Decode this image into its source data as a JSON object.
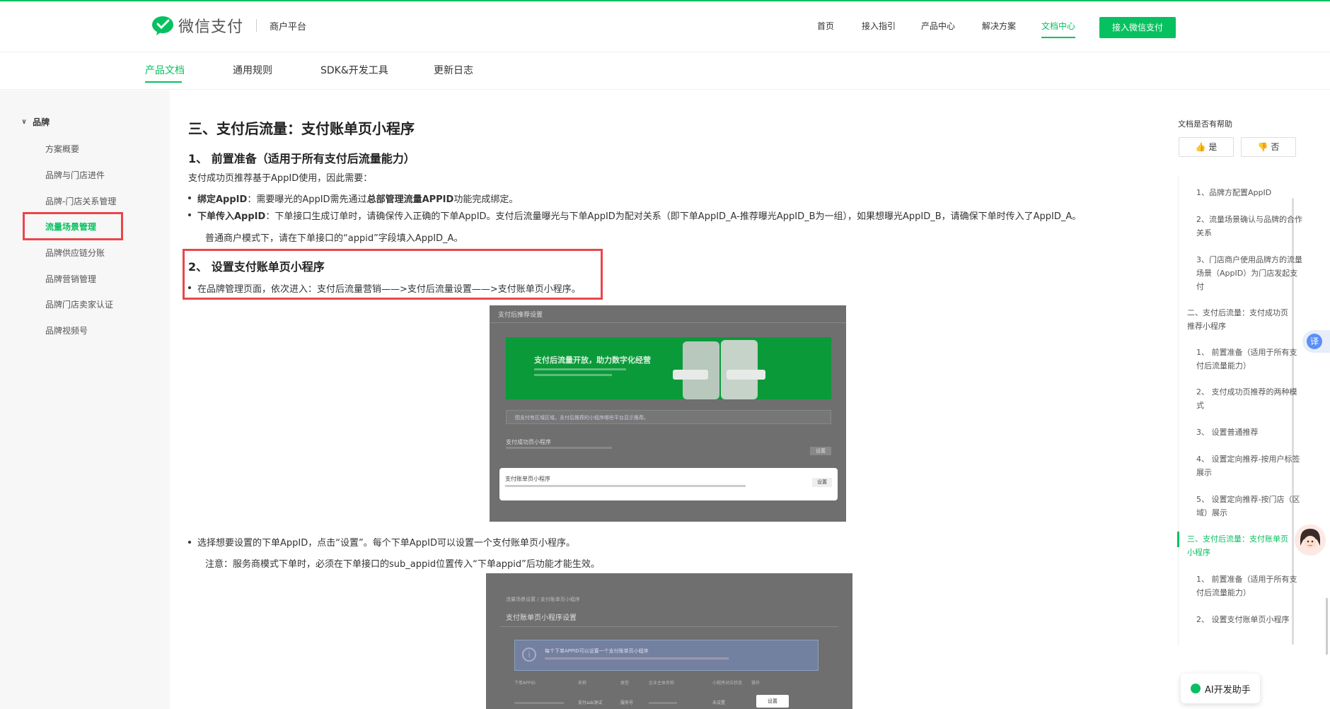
{
  "header": {
    "brand": "微信支付",
    "subbrand": "商户平台",
    "nav": [
      "首页",
      "接入指引",
      "产品中心",
      "解决方案",
      "文档中心"
    ],
    "active_nav": "文档中心",
    "cta": "接入微信支付"
  },
  "subnav": {
    "tabs": [
      "产品文档",
      "通用规则",
      "SDK&开发工具",
      "更新日志"
    ],
    "active": "产品文档"
  },
  "sidebar": {
    "group": "品牌",
    "items": [
      "方案概要",
      "品牌与门店进件",
      "品牌-门店关系管理",
      "流量场景管理",
      "品牌供应链分账",
      "品牌营销管理",
      "品牌门店卖家认证",
      "品牌视频号"
    ],
    "active": "流量场景管理"
  },
  "article": {
    "h1": "三、支付后流量：支付账单页小程序",
    "s1_title": "1、 前置准备（适用于所有支付后流量能力）",
    "s1_intro": "支付成功页推荐基于AppID使用，因此需要：",
    "b1_label": "绑定AppID",
    "b1_pre": "：需要曝光的AppID需先通过",
    "b1_bold": "总部管理流量APPID",
    "b1_post": "功能完成绑定。",
    "b2_label": "下单传入AppID",
    "b2_text": "：下单接口生成订单时，请确保传入正确的下单AppID。支付后流量曝光与下单AppID为配对关系（即下单AppID_A-推荐曝光AppID_B为一组），如果想曝光AppID_B，请确保下单时传入了AppID_A。",
    "b2_note": "普通商户模式下，请在下单接口的“appid”字段填入AppID_A。",
    "s2_title": "2、 设置支付账单页小程序",
    "s2_bullet": "在品牌管理页面，依次进入：支付后流量营销——>支付后流量设置——>支付账单页小程序。",
    "shot1": {
      "title": "支付后推荐设置",
      "banner": "支付后流量开放，助力数字化经营",
      "notice": "图支付有区域区域，支付后推荐的小程序哪些平台显示推荐。",
      "row1_title": "支付成功页小程序",
      "row1_button": "设置",
      "row2_title": "支付账单页小程序",
      "row2_button": "设置"
    },
    "s3_bullet": "选择想要设置的下单AppID，点击“设置”。每个下单AppID可以设置一个支付账单页小程序。",
    "s3_note": "注意：服务商模式下单时，必须在下单接口的sub_appid位置传入“下单appid”后功能才能生效。",
    "shot2": {
      "crumb": "流量场景设置 / 支付账单页小程序",
      "title": "支付账单页小程序设置",
      "info": "每个下单APPID可以设置一个支付账单页小程序",
      "headers": [
        "下单APPID",
        "名称",
        "类型",
        "企业主体名称",
        "小程序对应状态",
        "操作"
      ],
      "row": [
        "",
        "支付ask测试",
        "服务号",
        "",
        "未设置",
        "设置"
      ]
    }
  },
  "right": {
    "feedback_title": "文档是否有帮助",
    "yes": "是",
    "no": "否",
    "toc": [
      "1、品牌方配置AppID",
      "2、流量场景确认与品牌的合作关系",
      "3、门店商户使用品牌方的流量场景（AppID）为门店发起支付",
      "二、支付后流量：支付成功页推荐小程序",
      "1、 前置准备（适用于所有支付后流量能力）",
      "2、 支付成功页推荐的两种模式",
      "3、 设置普通推荐",
      "4、 设置定向推荐-按用户标签展示",
      "5、 设置定向推荐-按门店（区域）展示",
      "三、支付后流量：支付账单页小程序",
      "1、 前置准备（适用于所有支付后流量能力）",
      "2、 设置支付账单页小程序"
    ],
    "toc_active": "三、支付后流量：支付账单页小程序",
    "translate": "译",
    "ai_button": "AI开发助手"
  }
}
